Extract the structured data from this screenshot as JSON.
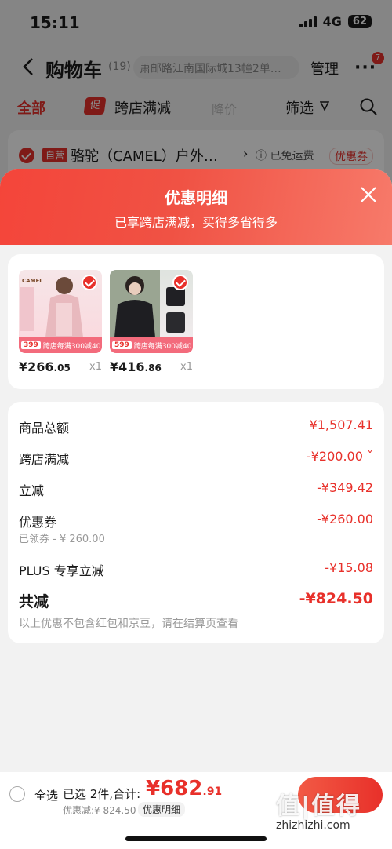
{
  "status_bar": {
    "time": "15:11",
    "network": "4G",
    "battery": "62"
  },
  "cart": {
    "title": "购物车",
    "count": "(19)",
    "address": "萧邮路江南国际城13幢2单…",
    "manage": "管理",
    "more_badge": "7",
    "tabs": {
      "all": "全部",
      "promo_badge": "促",
      "promo": "跨店满减",
      "price": "降价",
      "filter": "筛选"
    },
    "store": {
      "self_badge": "自营",
      "name": "骆驼（CAMEL）户外…",
      "free_shipping": "已免运费",
      "coupon": "优惠券"
    }
  },
  "sheet": {
    "title": "优惠明细",
    "subtitle": "已享跨店满减，买得多省得多",
    "goods": [
      {
        "brand": "CAMEL",
        "badge_price": "399",
        "badge_text": "跨店每满300减40",
        "price_int": "¥266",
        "price_dec": ".05",
        "qty": "x1"
      },
      {
        "brand": "",
        "badge_price": "599",
        "badge_text": "跨店每满300减40",
        "price_int": "¥416",
        "price_dec": ".86",
        "qty": "x1"
      }
    ],
    "rows": {
      "goods_total": {
        "label": "商品总额",
        "value": "¥1,507.41"
      },
      "cross_store": {
        "label": "跨店满减",
        "value": "-¥200.00 ˇ"
      },
      "instant": {
        "label": "立减",
        "value": "-¥349.42"
      },
      "coupon": {
        "label": "优惠券",
        "value": "-¥260.00",
        "sub": "已领券 - ¥ 260.00"
      },
      "plus": {
        "label": "PLUS 专享立减",
        "value": "-¥15.08"
      },
      "total": {
        "label": "共减",
        "value": "-¥824.50"
      }
    },
    "note": "以上优惠不包含红包和京豆，请在结算页查看"
  },
  "bottom_bar": {
    "select_all": "全选",
    "selected": "已选 2件,合计:",
    "total_int": "¥682",
    "total_dec": ".91",
    "discount": "优惠减:¥ 824.50",
    "discount_detail": "优惠明细",
    "watermark": "值|值得",
    "watermark_url": "zhizhizhi.com"
  },
  "colors": {
    "accent": "#e8302a",
    "header_gradient_start": "#f4453a",
    "header_gradient_end": "#f77a6a"
  }
}
